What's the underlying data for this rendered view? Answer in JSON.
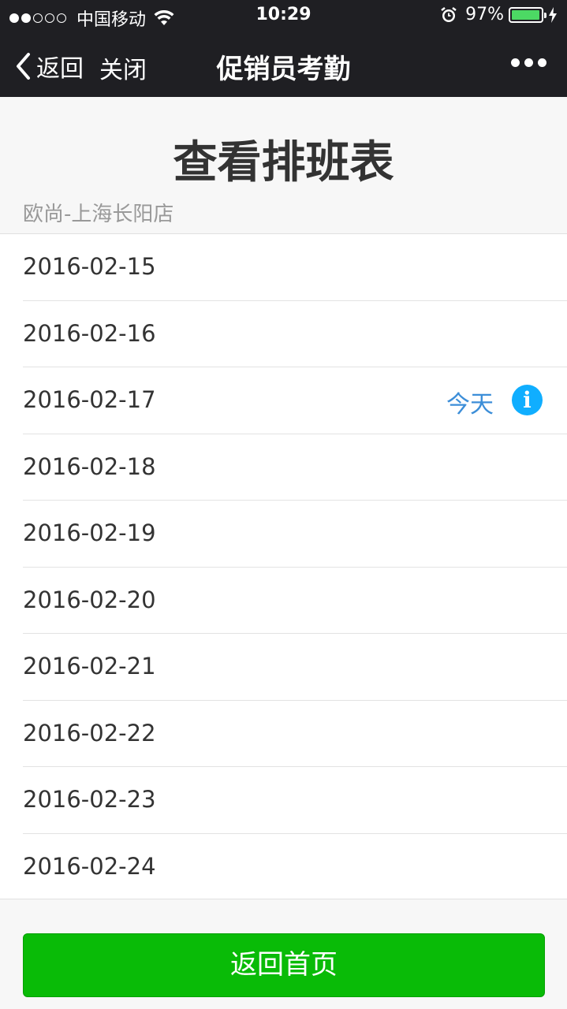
{
  "status_bar": {
    "carrier": "中国移动",
    "time": "10:29",
    "battery": "97%",
    "battery_level": 0.97
  },
  "nav": {
    "back_label": "返回",
    "close_label": "关闭",
    "title": "促销员考勤"
  },
  "header": {
    "title": "查看排班表",
    "store": "欧尚-上海长阳店"
  },
  "dates": [
    {
      "date": "2016-02-15"
    },
    {
      "date": "2016-02-16"
    },
    {
      "date": "2016-02-17",
      "today_label": "今天",
      "info_icon": "info-icon"
    },
    {
      "date": "2016-02-18"
    },
    {
      "date": "2016-02-19"
    },
    {
      "date": "2016-02-20"
    },
    {
      "date": "2016-02-21"
    },
    {
      "date": "2016-02-22"
    },
    {
      "date": "2016-02-23"
    },
    {
      "date": "2016-02-24"
    }
  ],
  "footer": {
    "home_button": "返回首页"
  },
  "colors": {
    "bar_bg": "#1f1f23",
    "accent_green": "#09bb07",
    "today_blue": "#3c8ed8",
    "info_blue": "#10aeff"
  }
}
